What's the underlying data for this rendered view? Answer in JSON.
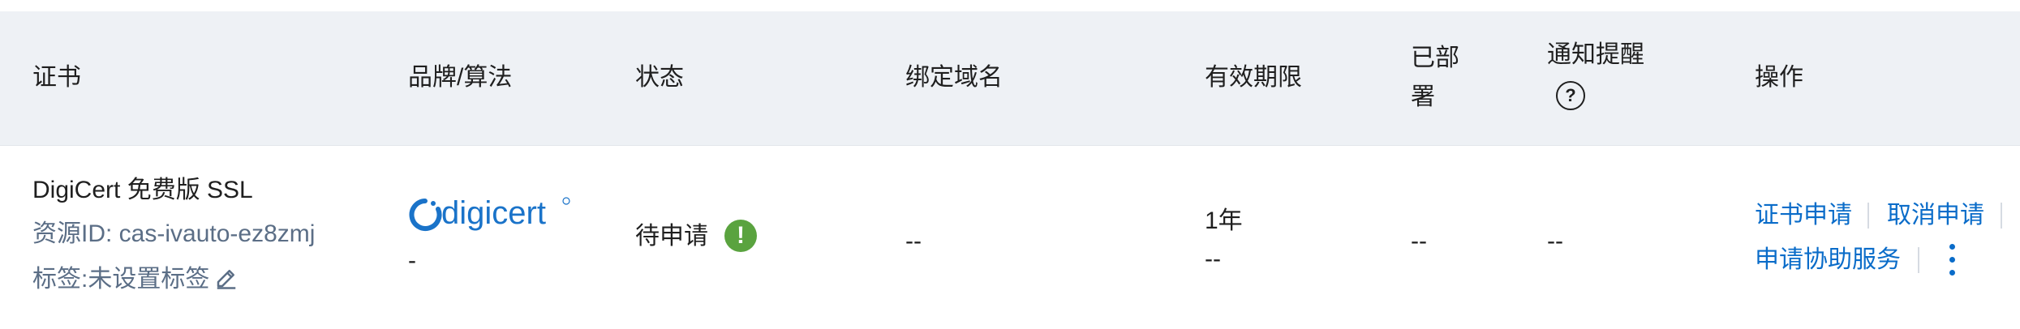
{
  "headers": {
    "certificate": "证书",
    "brand_algo": "品牌/算法",
    "status": "状态",
    "bound_domain": "绑定域名",
    "validity": "有效期限",
    "deployed_line1": "已部",
    "deployed_line2": "署",
    "notify": "通知提醒",
    "actions": "操作"
  },
  "row": {
    "cert_name": "DigiCert 免费版 SSL",
    "resource_id": "资源ID: cas-ivauto-ez8zmj",
    "tag": "标签:未设置标签",
    "brand_logo_text": "digicert",
    "brand_sub": "-",
    "status": "待申请",
    "bound_domain": "--",
    "validity_line1": "1年",
    "validity_line2": "--",
    "deployed": "--",
    "notify": "--",
    "actions": {
      "apply": "证书申请",
      "cancel": "取消申请",
      "assist": "申请协助服务"
    }
  },
  "colors": {
    "header_bg": "#eef1f5",
    "link": "#0a6cc9",
    "status_warning": "#5aa33f",
    "secondary_text": "#5b6e86",
    "digicert_blue": "#1a73c9"
  },
  "icons": [
    "help-circle-icon",
    "edit-pencil-icon",
    "warning-exclamation-icon",
    "more-vertical-icon",
    "digicert-logo"
  ]
}
